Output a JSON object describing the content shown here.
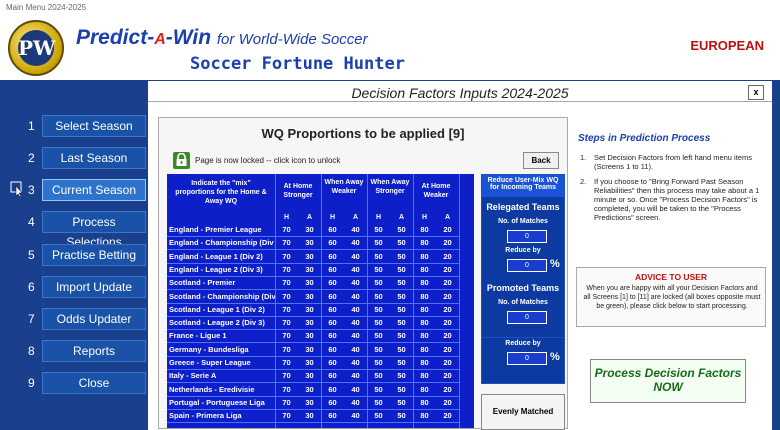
{
  "window": {
    "title": "Main Menu 2024-2025"
  },
  "header": {
    "logo_text": "PW",
    "title_part1": "Predict-",
    "title_part2": "A",
    "title_part3": "-Win",
    "title_sub": "for World-Wide Soccer",
    "subtitle": "Soccer Fortune Hunter",
    "region": "EUROPEAN"
  },
  "nav": [
    {
      "num": "1",
      "label": "Select Season"
    },
    {
      "num": "2",
      "label": "Last Season"
    },
    {
      "num": "3",
      "label": "Current Season"
    },
    {
      "num": "4",
      "label": "Process Selections"
    },
    {
      "num": "5",
      "label": "Practise Betting"
    },
    {
      "num": "6",
      "label": "Import Update"
    },
    {
      "num": "7",
      "label": "Odds Updater"
    },
    {
      "num": "8",
      "label": "Reports"
    },
    {
      "num": "9",
      "label": "Close"
    }
  ],
  "main": {
    "title": "Decision Factors Inputs 2024-2025",
    "close_label": "x",
    "panel_title": "WQ Proportions to be applied [9]",
    "lock_text": "Page is now locked -- click icon to unlock",
    "back_label": "Back",
    "grid_header": {
      "label": "Indicate the \"mix\" proportions for the Home & Away WQ",
      "groups": [
        "At Home Stronger",
        "When Away Weaker",
        "When Away Stronger",
        "At Home Weaker"
      ],
      "sub": [
        "H",
        "A",
        "H",
        "A",
        "H",
        "A",
        "H",
        "A"
      ]
    },
    "rows": [
      {
        "league": "England - Premier League",
        "vals": [
          "70",
          "30",
          "60",
          "40",
          "50",
          "50",
          "80",
          "20"
        ]
      },
      {
        "league": "England - Championship (Div 1)",
        "vals": [
          "70",
          "30",
          "60",
          "40",
          "50",
          "50",
          "80",
          "20"
        ]
      },
      {
        "league": "England - League 1 (Div 2)",
        "vals": [
          "70",
          "30",
          "60",
          "40",
          "50",
          "50",
          "80",
          "20"
        ]
      },
      {
        "league": "England - League 2 (Div 3)",
        "vals": [
          "70",
          "30",
          "60",
          "40",
          "50",
          "50",
          "80",
          "20"
        ]
      },
      {
        "league": "Scotland - Premier",
        "vals": [
          "70",
          "30",
          "60",
          "40",
          "50",
          "50",
          "80",
          "20"
        ]
      },
      {
        "league": "Scotland - Championship (Div 1)",
        "vals": [
          "70",
          "30",
          "60",
          "40",
          "50",
          "50",
          "80",
          "20"
        ]
      },
      {
        "league": "Scotland - League 1 (Div 2)",
        "vals": [
          "70",
          "30",
          "60",
          "40",
          "50",
          "50",
          "80",
          "20"
        ]
      },
      {
        "league": "Scotland - League 2 (Div 3)",
        "vals": [
          "70",
          "30",
          "60",
          "40",
          "50",
          "50",
          "80",
          "20"
        ]
      },
      {
        "league": "France - Ligue 1",
        "vals": [
          "70",
          "30",
          "60",
          "40",
          "50",
          "50",
          "80",
          "20"
        ]
      },
      {
        "league": "Germany - Bundesliga",
        "vals": [
          "70",
          "30",
          "60",
          "40",
          "50",
          "50",
          "80",
          "20"
        ]
      },
      {
        "league": "Greece - Super League",
        "vals": [
          "70",
          "30",
          "60",
          "40",
          "50",
          "50",
          "80",
          "20"
        ]
      },
      {
        "league": "Italy - Serie A",
        "vals": [
          "70",
          "30",
          "60",
          "40",
          "50",
          "50",
          "80",
          "20"
        ]
      },
      {
        "league": "Netherlands - Eredivisie",
        "vals": [
          "70",
          "30",
          "60",
          "40",
          "50",
          "50",
          "80",
          "20"
        ]
      },
      {
        "league": "Portugal - Portuguese Liga",
        "vals": [
          "70",
          "30",
          "60",
          "40",
          "50",
          "50",
          "80",
          "20"
        ]
      },
      {
        "league": "Spain - Primera Liga",
        "vals": [
          "70",
          "30",
          "60",
          "40",
          "50",
          "50",
          "80",
          "20"
        ]
      }
    ],
    "reduce_panel": {
      "header": "Reduce User-Mix WQ for Incoming Teams",
      "relegated_title": "Relegated Teams",
      "promoted_title": "Promoted Teams",
      "matches_label": "No. of Matches",
      "reduce_label": "Reduce by",
      "relegated_matches": "0",
      "relegated_reduce": "0",
      "promoted_matches": "0",
      "promoted_reduce": "0",
      "pct": "%"
    },
    "evenly_label": "Evenly Matched",
    "steps_title": "Steps in Prediction Process",
    "steps": [
      {
        "n": "1.",
        "text": "Set Decision Factors from left hand menu items (Screens 1 to 11)."
      },
      {
        "n": "2.",
        "text": "If you choose to \"Bring Forward Past Season Reliabilities\" then this process may take about a 1 minute or so. Once \"Process Decision Factors\" is completed, you will be taken to the \"Process Predictions\" screen."
      }
    ],
    "advice_title": "ADVICE TO USER",
    "advice_text": "When you are happy with all your Decision Factors and all Screens [1] to [11] are locked (all boxes opposite must be green), please click below to start processing.",
    "process_line1": "Process Decision Factors",
    "process_line2": "NOW"
  }
}
